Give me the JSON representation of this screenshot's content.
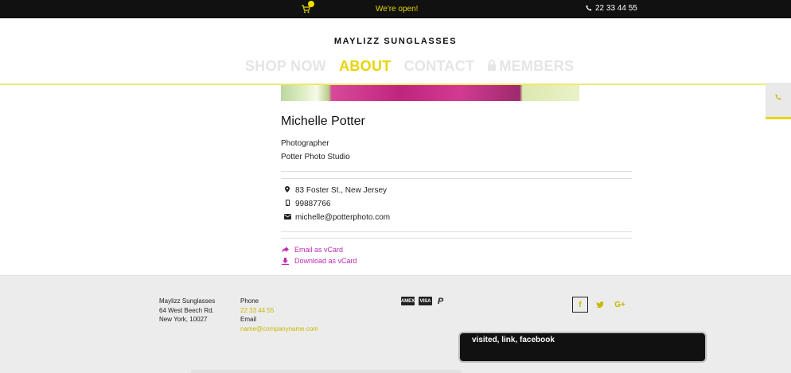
{
  "topbar": {
    "open_text": "We're open!",
    "phone": "22 33 44 55"
  },
  "header": {
    "brand": "MAYLIZZ SUNGLASSES",
    "nav": [
      {
        "label": "SHOP NOW"
      },
      {
        "label": "ABOUT"
      },
      {
        "label": "CONTACT"
      },
      {
        "label": "MEMBERS"
      }
    ]
  },
  "profile": {
    "name": "Michelle Potter",
    "role": "Photographer",
    "company": "Potter Photo Studio",
    "address": "83 Foster St., New Jersey",
    "mobile": "99887766",
    "email": "michelle@potterphoto.com",
    "actions": {
      "email_vcard": "Email as vCard",
      "download_vcard": "Download as vCard"
    }
  },
  "footer": {
    "company": "Maylizz Sunglasses",
    "street": "64 West Beech Rd.",
    "city": "New York,  10027",
    "phone_label": "Phone",
    "phone": "22 33 44 55",
    "email_label": "Email",
    "email": "name@companyname.com",
    "payments": [
      "AMEX",
      "VISA",
      "P"
    ]
  },
  "tooltip": {
    "text": "visited, link, facebook"
  },
  "colors": {
    "accent": "#e8d400",
    "link_magenta": "#c02ab2",
    "topbar_bg": "#111111",
    "footer_bg": "#ececec"
  }
}
